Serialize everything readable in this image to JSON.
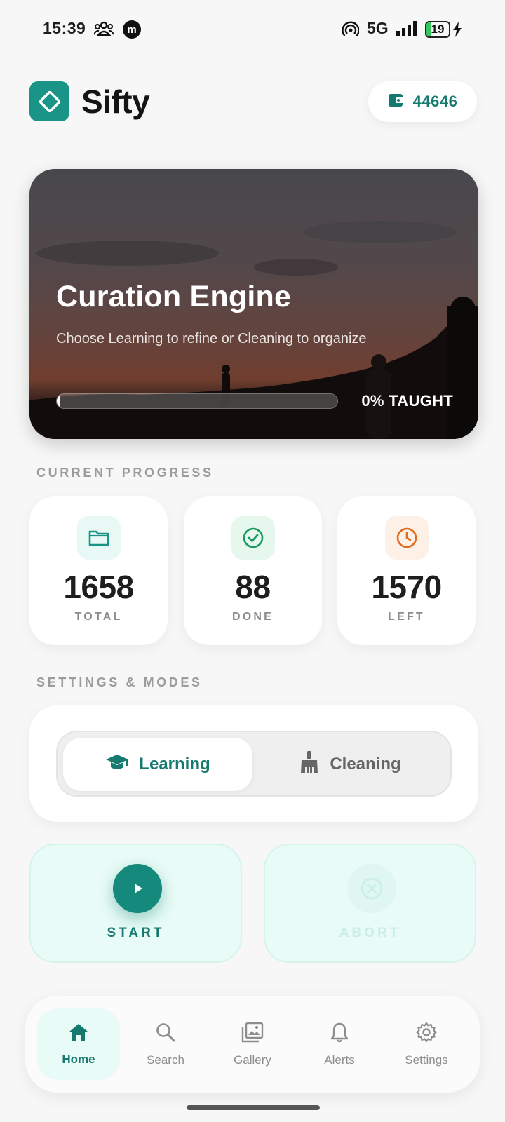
{
  "status_bar": {
    "time": "15:39",
    "network": "5G",
    "battery": "19",
    "icons": [
      "people-icon",
      "m-app-icon",
      "hotspot-icon",
      "signal-icon",
      "battery-icon",
      "charging-icon"
    ]
  },
  "header": {
    "app_name": "Sifty",
    "coins": "44646",
    "icons": [
      "diamond-logo-icon",
      "wallet-icon"
    ]
  },
  "hero": {
    "title": "Curation Engine",
    "subtitle": "Choose Learning to refine or Cleaning to organize",
    "progress": 0.01,
    "progress_label": "0% TAUGHT"
  },
  "progress_section": {
    "label": "CURRENT PROGRESS",
    "stats": [
      {
        "value": "1658",
        "label": "TOTAL",
        "icon": "folder-icon",
        "color": "#1a9486"
      },
      {
        "value": "88",
        "label": "DONE",
        "icon": "check-circle-icon",
        "color": "#1a9a5e"
      },
      {
        "value": "1570",
        "label": "LEFT",
        "icon": "clock-icon",
        "color": "#e06a1f"
      }
    ]
  },
  "settings_section": {
    "label": "SETTINGS & MODES",
    "modes": [
      {
        "label": "Learning",
        "icon": "graduation-cap-icon",
        "selected": true
      },
      {
        "label": "Cleaning",
        "icon": "broom-icon",
        "selected": false
      }
    ]
  },
  "actions": {
    "start_label": "START",
    "abort_label": "ABORT"
  },
  "nav": {
    "items": [
      {
        "label": "Home",
        "icon": "home-icon",
        "active": true
      },
      {
        "label": "Search",
        "icon": "search-icon",
        "active": false
      },
      {
        "label": "Gallery",
        "icon": "gallery-icon",
        "active": false
      },
      {
        "label": "Alerts",
        "icon": "bell-icon",
        "active": false
      },
      {
        "label": "Settings",
        "icon": "gear-icon",
        "active": false
      }
    ]
  },
  "colors": {
    "accent": "#16796f",
    "accent_bright": "#15897b",
    "background": "#f6f7f6",
    "action_bg": "#e9fbf6"
  }
}
